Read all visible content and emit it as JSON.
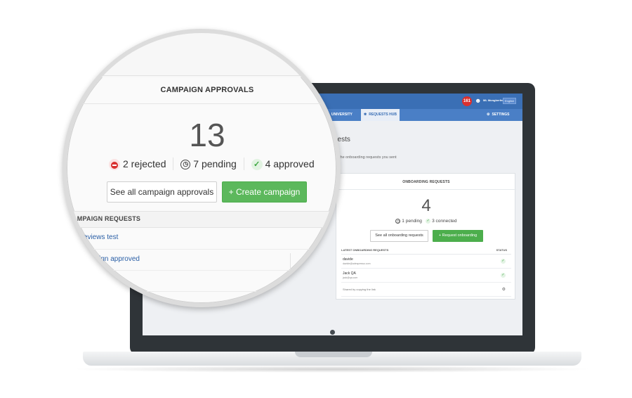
{
  "screen": {
    "notifications": "161",
    "user_name": "ML Mongberfeel",
    "language": "English",
    "nav": {
      "university": "UNIVERSITY",
      "requests_hub": "REQUESTS HUB",
      "settings": "SETTINGS"
    },
    "page_heading": "uests",
    "page_subtitle": "the onboarding requests you sent",
    "onboarding": {
      "title": "ONBOARDING REQUESTS",
      "count": "4",
      "pending": "1 pending",
      "connected": "3 connected",
      "see_all_label": "See all onboarding requests",
      "request_label": "Request onboarding",
      "table_header": "LATEST ONBOARDING REQUESTS",
      "status_header": "STATUS",
      "rows": [
        {
          "name": "davide",
          "email": "davide@adespresso.com"
        },
        {
          "name": "Jack QA",
          "email": "jack@qa.com"
        },
        {
          "name": "Shared by copying the link",
          "email": ""
        }
      ]
    }
  },
  "magnifier": {
    "title": "CAMPAIGN APPROVALS",
    "count": "13",
    "rejected": "2 rejected",
    "pending": "7 pending",
    "approved": "4 approved",
    "see_all_label": "See all campaign approvals",
    "create_label": "Create campaign",
    "section_label": "T CAMPAIGN REQUESTS",
    "link1": "previews test",
    "link2": "naign approved"
  },
  "colors": {
    "topbar": "#3a6fb5",
    "green_button": "#5cb85c",
    "rejected_red": "#d9302f",
    "approved_green": "#3aa63e",
    "link_blue": "#2a5fa6"
  }
}
